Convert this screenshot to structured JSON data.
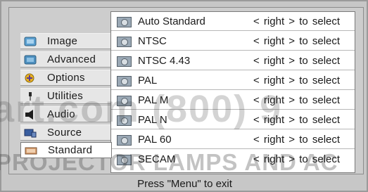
{
  "menu": {
    "items": [
      {
        "label": "Image",
        "icon": "image-icon",
        "active": false
      },
      {
        "label": "Advanced",
        "icon": "advanced-icon",
        "active": false
      },
      {
        "label": "Options",
        "icon": "options-icon",
        "active": false
      },
      {
        "label": "Utilities",
        "icon": "utilities-icon",
        "active": false
      },
      {
        "label": "Audio",
        "icon": "speaker-icon",
        "active": false
      },
      {
        "label": "Source",
        "icon": "source-icon",
        "active": false
      },
      {
        "label": "Standard",
        "icon": "standard-icon",
        "active": true
      }
    ]
  },
  "options": {
    "rows": [
      {
        "label": "Auto Standard",
        "hint": "< right > to select"
      },
      {
        "label": "NTSC",
        "hint": "< right > to select"
      },
      {
        "label": "NTSC 4.43",
        "hint": "< right > to select"
      },
      {
        "label": "PAL",
        "hint": "< right > to select"
      },
      {
        "label": "PAL M",
        "hint": "< right > to select"
      },
      {
        "label": "PAL N",
        "hint": "< right > to select"
      },
      {
        "label": "PAL 60",
        "hint": "< right > to select"
      },
      {
        "label": "SECAM",
        "hint": "< right > to select"
      }
    ]
  },
  "footer": {
    "text": "Press \"Menu\" to exit"
  },
  "watermark": {
    "line1": "art.com (800) 9",
    "line2": "PROJECTOR LAMPS AND AC"
  }
}
